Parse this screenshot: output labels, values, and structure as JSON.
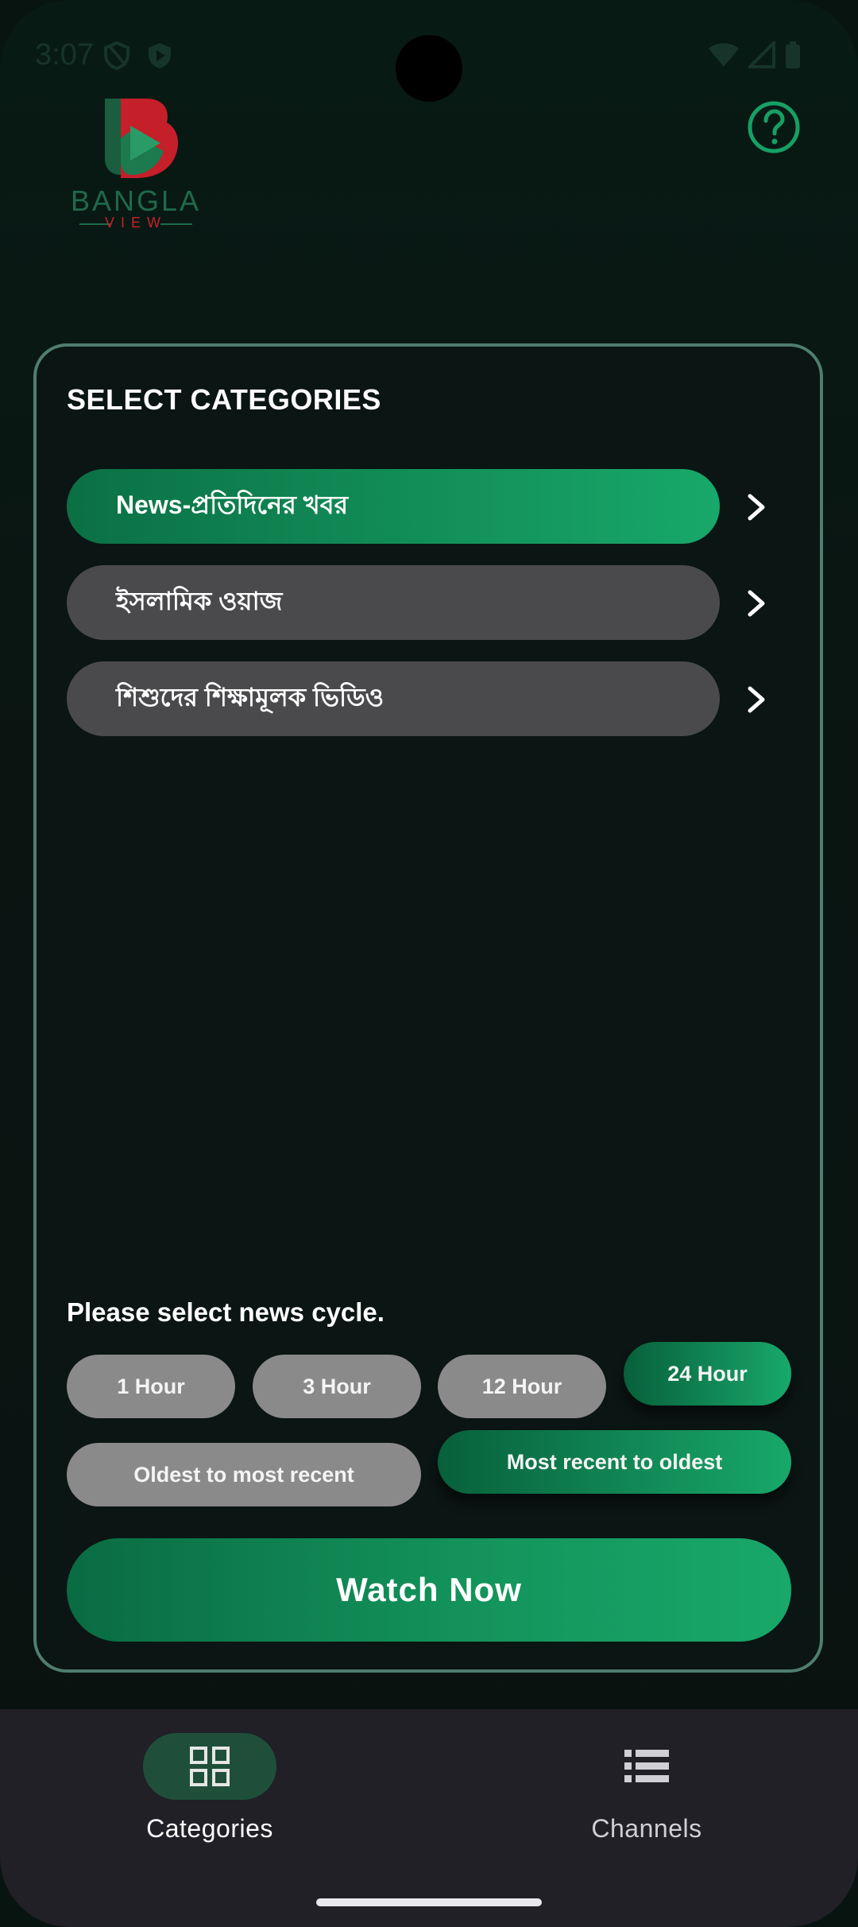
{
  "status_bar": {
    "time": "3:07",
    "icons": [
      "shield-icon",
      "play-protect-icon",
      "wifi-icon",
      "signal-icon",
      "battery-icon"
    ]
  },
  "header": {
    "logo_brand": "BANGLA",
    "logo_sub": "VIEW",
    "help_icon": "question-circle-icon"
  },
  "categories": {
    "title": "SELECT CATEGORIES",
    "items": [
      {
        "label": "News-প্রতিদিনের খবর",
        "selected": true
      },
      {
        "label": "ইসলামিক ওয়াজ",
        "selected": false
      },
      {
        "label": "শিশুদের শিক্ষামূলক ভিডিও",
        "selected": false
      }
    ]
  },
  "news_cycle": {
    "label": "Please select news cycle.",
    "hours": [
      {
        "label": "1 Hour",
        "selected": false
      },
      {
        "label": "3 Hour",
        "selected": false
      },
      {
        "label": "12 Hour",
        "selected": false
      },
      {
        "label": "24 Hour",
        "selected": true
      }
    ],
    "order": [
      {
        "label": "Oldest to most recent",
        "selected": false
      },
      {
        "label": "Most recent to oldest",
        "selected": true
      }
    ]
  },
  "watch_now": "Watch Now",
  "bottom_nav": [
    {
      "label": "Categories",
      "icon": "grid-icon",
      "active": true
    },
    {
      "label": "Channels",
      "icon": "list-icon",
      "active": false
    }
  ],
  "colors": {
    "accent_green": "#18a86a",
    "dark_green": "#0b7044",
    "logo_red": "#c8202a",
    "inactive_pill": "#8a8a8a",
    "category_inactive": "#4a4a4c"
  }
}
